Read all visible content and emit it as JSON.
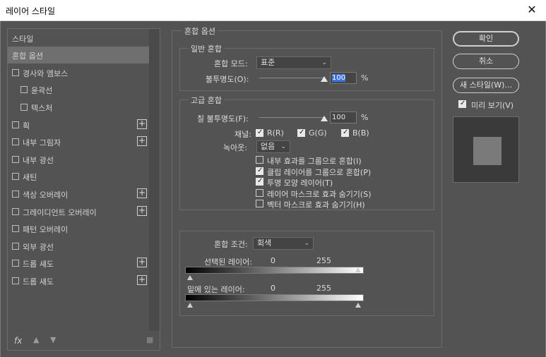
{
  "window": {
    "title": "레이어 스타일"
  },
  "sidebar": {
    "items": [
      {
        "label": "스타일",
        "checkbox": false,
        "plus": false,
        "indent": 0,
        "selected": false
      },
      {
        "label": "혼합 옵션",
        "checkbox": false,
        "plus": false,
        "indent": 0,
        "selected": true
      },
      {
        "label": "경사와 엠보스",
        "checkbox": true,
        "plus": false,
        "indent": 0,
        "selected": false
      },
      {
        "label": "윤곽선",
        "checkbox": true,
        "plus": false,
        "indent": 1,
        "selected": false
      },
      {
        "label": "텍스처",
        "checkbox": true,
        "plus": false,
        "indent": 1,
        "selected": false
      },
      {
        "label": "획",
        "checkbox": true,
        "plus": true,
        "indent": 0,
        "selected": false
      },
      {
        "label": "내부 그림자",
        "checkbox": true,
        "plus": true,
        "indent": 0,
        "selected": false
      },
      {
        "label": "내부 광선",
        "checkbox": true,
        "plus": false,
        "indent": 0,
        "selected": false
      },
      {
        "label": "새틴",
        "checkbox": true,
        "plus": false,
        "indent": 0,
        "selected": false
      },
      {
        "label": "색상 오버레이",
        "checkbox": true,
        "plus": true,
        "indent": 0,
        "selected": false
      },
      {
        "label": "그레이디언트 오버레이",
        "checkbox": true,
        "plus": true,
        "indent": 0,
        "selected": false
      },
      {
        "label": "패턴 오버레이",
        "checkbox": true,
        "plus": false,
        "indent": 0,
        "selected": false
      },
      {
        "label": "외부 광선",
        "checkbox": true,
        "plus": false,
        "indent": 0,
        "selected": false
      },
      {
        "label": "드롭 섀도",
        "checkbox": true,
        "plus": true,
        "indent": 0,
        "selected": false
      },
      {
        "label": "드롭 섀도",
        "checkbox": true,
        "plus": true,
        "indent": 0,
        "selected": false
      }
    ],
    "footer": {
      "fx": "fx"
    }
  },
  "blend": {
    "section_title": "혼합 옵션",
    "general": {
      "title": "일반 혼합",
      "mode_label": "혼합 모드:",
      "mode_value": "표준",
      "opacity_label": "불투명도(O):",
      "opacity_value": "100",
      "opacity_unit": "%"
    },
    "advanced": {
      "title": "고급 혼합",
      "fill_label": "칠 불투명도(F):",
      "fill_value": "100",
      "fill_unit": "%",
      "channels_label": "채널:",
      "channel_r": "R(R)",
      "channel_g": "G(G)",
      "channel_b": "B(B)",
      "knockout_label": "녹아웃:",
      "knockout_value": "없음",
      "options": [
        {
          "label": "내부 효과를 그룹으로 혼합(I)",
          "checked": false
        },
        {
          "label": "클립 레이어를 그룹으로 혼합(P)",
          "checked": true
        },
        {
          "label": "투명 모양 레이어(T)",
          "checked": true
        },
        {
          "label": "레이어 마스크로 효과 숨기기(S)",
          "checked": false
        },
        {
          "label": "벡터 마스크로 효과 숨기기(H)",
          "checked": false
        }
      ]
    },
    "blend_if": {
      "label": "혼합 조건:",
      "value": "회색",
      "this_layer_label": "선택된 레이어:",
      "this_min": "0",
      "this_max": "255",
      "under_layer_label": "밑에 있는 레이어:",
      "under_min": "0",
      "under_max": "255"
    }
  },
  "actions": {
    "ok": "확인",
    "cancel": "취소",
    "new_style": "새 스타일(W)...",
    "preview_label": "미리 보기(V)",
    "preview_checked": true
  },
  "colors": {
    "panel": "#535353",
    "border": "#6a6a6a",
    "selection": "#6f6f6f",
    "highlight": "#3b73d8"
  },
  "icons": {
    "close": "close-icon",
    "plus": "plus-icon",
    "up": "arrow-up-icon",
    "down": "arrow-down-icon",
    "trash": "trash-icon"
  }
}
